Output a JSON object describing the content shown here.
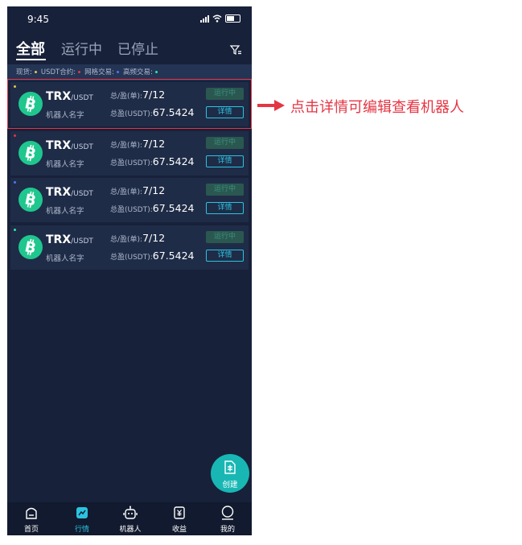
{
  "status_bar": {
    "time": "9:45"
  },
  "tabs": [
    {
      "label": "全部",
      "active": true
    },
    {
      "label": "运行中",
      "active": false
    },
    {
      "label": "已停止",
      "active": false
    }
  ],
  "legend": [
    {
      "label": "现货:",
      "color": "#e8c34a"
    },
    {
      "label": "USDT合约:",
      "color": "#e53543"
    },
    {
      "label": "网格交易:",
      "color": "#4f76ff"
    },
    {
      "label": "高频交易:",
      "color": "#2ee6a8"
    }
  ],
  "cards": [
    {
      "dot_color": "#e8c34a",
      "symbol": "TRX",
      "quote": "/USDT",
      "name": "机器人名字",
      "ratio_label": "总/盈(单):",
      "ratio_value": "7/12",
      "profit_label": "总盈(USDT):",
      "profit_value": "67.5424",
      "status": "运行中",
      "detail": "详情"
    },
    {
      "dot_color": "#e53543",
      "symbol": "TRX",
      "quote": "/USDT",
      "name": "机器人名字",
      "ratio_label": "总/盈(单):",
      "ratio_value": "7/12",
      "profit_label": "总盈(USDT):",
      "profit_value": "67.5424",
      "status": "运行中",
      "detail": "详情"
    },
    {
      "dot_color": "#4f76ff",
      "symbol": "TRX",
      "quote": "/USDT",
      "name": "机器人名字",
      "ratio_label": "总/盈(单):",
      "ratio_value": "7/12",
      "profit_label": "总盈(USDT):",
      "profit_value": "67.5424",
      "status": "运行中",
      "detail": "详情"
    },
    {
      "dot_color": "#2ee6a8",
      "symbol": "TRX",
      "quote": "/USDT",
      "name": "机器人名字",
      "ratio_label": "总/盈(单):",
      "ratio_value": "7/12",
      "profit_label": "总盈(USDT):",
      "profit_value": "67.5424",
      "status": "运行中",
      "detail": "详情"
    }
  ],
  "fab": {
    "label": "创建",
    "icon": "document-add-icon"
  },
  "tabbar": [
    {
      "label": "首页",
      "icon": "home-icon",
      "active": false
    },
    {
      "label": "行情",
      "icon": "chart-icon",
      "active": true
    },
    {
      "label": "机器人",
      "icon": "robot-icon",
      "active": false
    },
    {
      "label": "收益",
      "icon": "yen-icon",
      "active": false
    },
    {
      "label": "我的",
      "icon": "profile-icon",
      "active": false
    }
  ],
  "annotation": {
    "text": "点击详情可编辑查看机器人",
    "color": "#e53543"
  },
  "colors": {
    "background": "#18213a",
    "card": "#1f2c47",
    "accent": "#2bc3e0",
    "coin": "#1fc78e",
    "highlight": "#e53543"
  }
}
